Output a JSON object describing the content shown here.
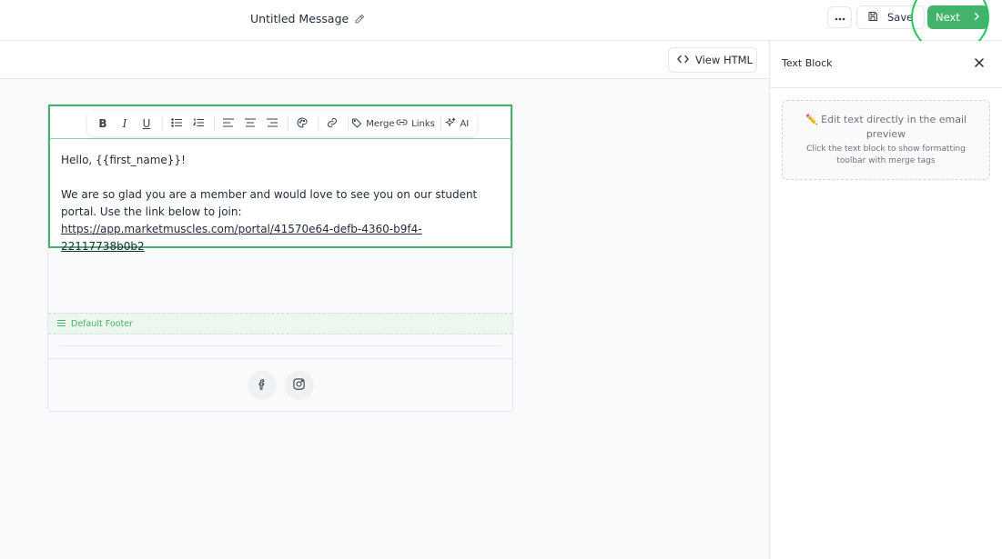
{
  "header": {
    "title": "Untitled Message",
    "save_label": "Save",
    "next_label": "Next"
  },
  "editor": {
    "view_html_label": "View HTML",
    "toolbar": {
      "bold": "B",
      "italic": "I",
      "underline": "U",
      "merge_label": "Merge",
      "links_label": "Links",
      "ai_label": "AI"
    },
    "email": {
      "greeting": "Hello, {{first_name}}!",
      "paragraph": "We are so glad you are a member and would love to see you on our student portal. Use the link below to join: ",
      "link": "https://app.marketmuscles.com/portal/41570e64-defb-4360-b9f4-22117738b0b2",
      "footer_label": "Default Footer"
    }
  },
  "panel": {
    "title": "Text Block",
    "hint_main": "✏️ Edit text directly in the email preview",
    "hint_sub": "Click the text block to show formatting toolbar with merge tags"
  },
  "colors": {
    "accent": "#43b26a",
    "highlight": "#22c55e"
  }
}
